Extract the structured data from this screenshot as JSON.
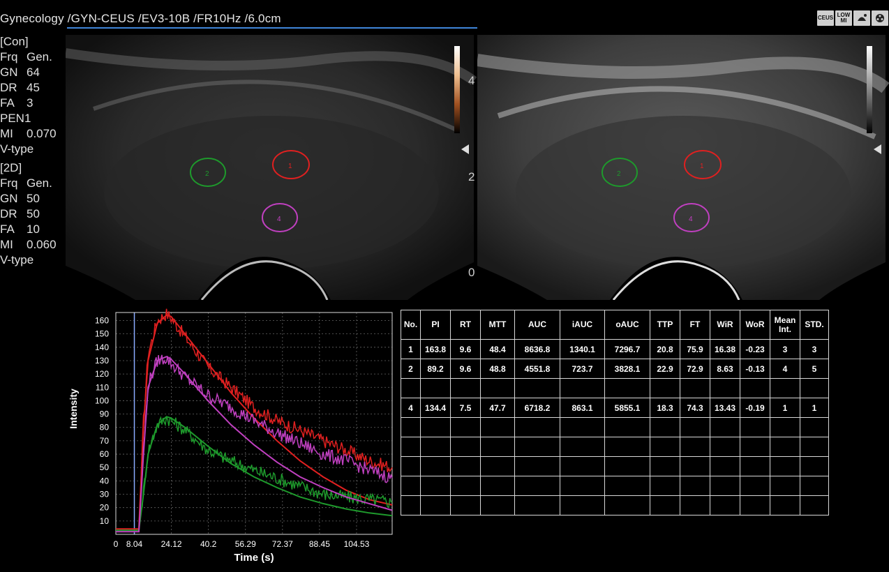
{
  "header": {
    "title": "Gynecology /GYN-CEUS /EV3-10B /FR10Hz /6.0cm",
    "mode_icons": [
      "CEUS",
      "LOW MI",
      "probe-icon",
      "film-icon"
    ]
  },
  "params_con": {
    "title": "[Con]",
    "rows": [
      {
        "k": "Frq",
        "v": "Gen."
      },
      {
        "k": "GN",
        "v": "64"
      },
      {
        "k": "DR",
        "v": "45"
      },
      {
        "k": "FA",
        "v": "3"
      },
      {
        "k": "PEN1",
        "v": ""
      },
      {
        "k": "MI",
        "v": "0.070"
      },
      {
        "k": "V-type",
        "v": ""
      }
    ]
  },
  "params_2d": {
    "title": "[2D]",
    "rows": [
      {
        "k": "Frq",
        "v": "Gen."
      },
      {
        "k": "GN",
        "v": "50"
      },
      {
        "k": "DR",
        "v": "50"
      },
      {
        "k": "FA",
        "v": "10"
      },
      {
        "k": "MI",
        "v": "0.060"
      },
      {
        "k": "V-type",
        "v": ""
      }
    ]
  },
  "images": {
    "roi_labels": [
      "1",
      "2",
      "4"
    ],
    "roi_colors": {
      "1": "#e02020",
      "2": "#1e9a2c",
      "4": "#c040c0"
    },
    "depth_scale": [
      "4",
      "2",
      "0"
    ]
  },
  "chart_data": {
    "type": "line",
    "xlabel": "Time (s)",
    "ylabel": "Intensity",
    "xticks": [
      "0",
      "8.04",
      "24.12",
      "40.2",
      "56.29",
      "72.37",
      "88.45",
      "104.53"
    ],
    "xtick_values": [
      0,
      8.04,
      24.12,
      40.2,
      56.29,
      72.37,
      88.45,
      104.53
    ],
    "yticks": [
      "10",
      "20",
      "30",
      "40",
      "50",
      "60",
      "70",
      "80",
      "90",
      "100",
      "110",
      "120",
      "130",
      "140",
      "150",
      "160"
    ],
    "xlim": [
      0,
      120
    ],
    "ylim": [
      0,
      166
    ],
    "grid": true,
    "marker_x": 8.04,
    "series": [
      {
        "name": "1",
        "color": "#e02020",
        "fit": {
          "x": [
            0,
            10,
            12,
            14,
            18,
            22,
            24,
            30,
            40,
            50,
            60,
            70,
            80,
            90,
            100,
            110,
            120
          ],
          "y": [
            4,
            4,
            80,
            130,
            158,
            164,
            163,
            150,
            128,
            106,
            87,
            70,
            55,
            43,
            33,
            26,
            22
          ]
        },
        "raw": {
          "x": [
            0,
            10,
            12,
            14,
            18,
            22,
            24,
            30,
            40,
            50,
            60,
            70,
            80,
            90,
            100,
            110,
            120
          ],
          "y": [
            4,
            4,
            85,
            135,
            160,
            165,
            162,
            148,
            125,
            110,
            95,
            85,
            78,
            70,
            63,
            55,
            50
          ]
        }
      },
      {
        "name": "2",
        "color": "#1e9a2c",
        "fit": {
          "x": [
            0,
            10,
            12,
            14,
            18,
            22,
            24,
            30,
            40,
            50,
            60,
            70,
            80,
            90,
            100,
            110,
            120
          ],
          "y": [
            3,
            3,
            30,
            60,
            82,
            88,
            87,
            80,
            66,
            53,
            43,
            35,
            28,
            23,
            19,
            16,
            14
          ]
        },
        "raw": {
          "x": [
            0,
            10,
            12,
            14,
            18,
            22,
            24,
            30,
            40,
            50,
            60,
            70,
            80,
            90,
            100,
            110,
            120
          ],
          "y": [
            3,
            3,
            32,
            62,
            82,
            87,
            85,
            78,
            63,
            55,
            48,
            42,
            36,
            30,
            28,
            26,
            24
          ]
        }
      },
      {
        "name": "4",
        "color": "#c040c0",
        "fit": {
          "x": [
            0,
            10,
            12,
            14,
            18,
            22,
            24,
            30,
            40,
            50,
            60,
            70,
            80,
            90,
            100,
            110,
            120
          ],
          "y": [
            2,
            2,
            60,
            110,
            130,
            133,
            131,
            120,
            100,
            82,
            67,
            54,
            43,
            35,
            28,
            23,
            18
          ]
        },
        "raw": {
          "x": [
            0,
            10,
            12,
            14,
            18,
            22,
            24,
            30,
            40,
            50,
            60,
            70,
            80,
            90,
            100,
            110,
            120
          ],
          "y": [
            2,
            2,
            62,
            112,
            130,
            132,
            128,
            118,
            104,
            95,
            85,
            76,
            68,
            60,
            55,
            48,
            42
          ]
        }
      }
    ]
  },
  "table": {
    "headers": [
      "No.",
      "PI",
      "RT",
      "MTT",
      "AUC",
      "iAUC",
      "oAUC",
      "TTP",
      "FT",
      "WiR",
      "WoR",
      "Mean\nInt.",
      "STD."
    ],
    "rows": [
      [
        "1",
        "163.8",
        "9.6",
        "48.4",
        "8636.8",
        "1340.1",
        "7296.7",
        "20.8",
        "75.9",
        "16.38",
        "-0.23",
        "3",
        "3"
      ],
      [
        "2",
        "89.2",
        "9.6",
        "48.8",
        "4551.8",
        "723.7",
        "3828.1",
        "22.9",
        "72.9",
        "8.63",
        "-0.13",
        "4",
        "5"
      ],
      [
        "",
        "",
        "",
        "",
        "",
        "",
        "",
        "",
        "",
        "",
        "",
        "",
        ""
      ],
      [
        "4",
        "134.4",
        "7.5",
        "47.7",
        "6718.2",
        "863.1",
        "5855.1",
        "18.3",
        "74.3",
        "13.43",
        "-0.19",
        "1",
        "1"
      ],
      [
        "",
        "",
        "",
        "",
        "",
        "",
        "",
        "",
        "",
        "",
        "",
        "",
        ""
      ],
      [
        "",
        "",
        "",
        "",
        "",
        "",
        "",
        "",
        "",
        "",
        "",
        "",
        ""
      ],
      [
        "",
        "",
        "",
        "",
        "",
        "",
        "",
        "",
        "",
        "",
        "",
        "",
        ""
      ],
      [
        "",
        "",
        "",
        "",
        "",
        "",
        "",
        "",
        "",
        "",
        "",
        "",
        ""
      ],
      [
        "",
        "",
        "",
        "",
        "",
        "",
        "",
        "",
        "",
        "",
        "",
        "",
        ""
      ]
    ]
  }
}
